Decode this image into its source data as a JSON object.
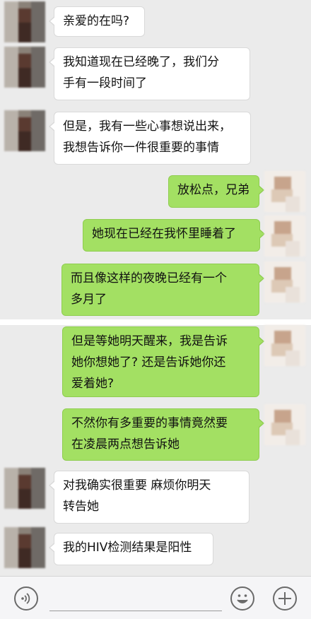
{
  "chat": {
    "messages": [
      {
        "side": "left",
        "lines": [
          "亲爱的在吗?"
        ]
      },
      {
        "side": "left",
        "lines": [
          "我知道现在已经晚了，我们分",
          "手有一段时间了"
        ]
      },
      {
        "side": "left",
        "lines": [
          "但是，我有一些心事想说出来，",
          "我想告诉你一件很重要的事情"
        ]
      },
      {
        "side": "right",
        "lines": [
          "放松点，兄弟"
        ]
      },
      {
        "side": "right",
        "lines": [
          "她现在已经在我怀里睡着了"
        ]
      },
      {
        "side": "right",
        "lines": [
          "而且像这样的夜晚已经有一个",
          "多月了"
        ]
      },
      {
        "side": "right",
        "lines": [
          "但是等她明天醒来，我是告诉",
          "她你想她了? 还是告诉她你还",
          "爱着她?"
        ]
      },
      {
        "side": "right",
        "lines": [
          "不然你有多重要的事情竟然要",
          "在凌晨两点想告诉她"
        ]
      },
      {
        "side": "left",
        "lines": [
          "对我确实很重要   麻烦你明天",
          "转告她"
        ]
      },
      {
        "side": "left",
        "lines": [
          "我的HIV检测结果是阳性"
        ]
      }
    ]
  },
  "input_bar": {
    "voice_icon": "voice-icon",
    "emoji_icon": "emoji-icon",
    "plus_icon": "plus-icon",
    "placeholder": ""
  },
  "colors": {
    "background": "#ebebeb",
    "sent_bubble": "#a3e063",
    "received_bubble": "#ffffff"
  }
}
